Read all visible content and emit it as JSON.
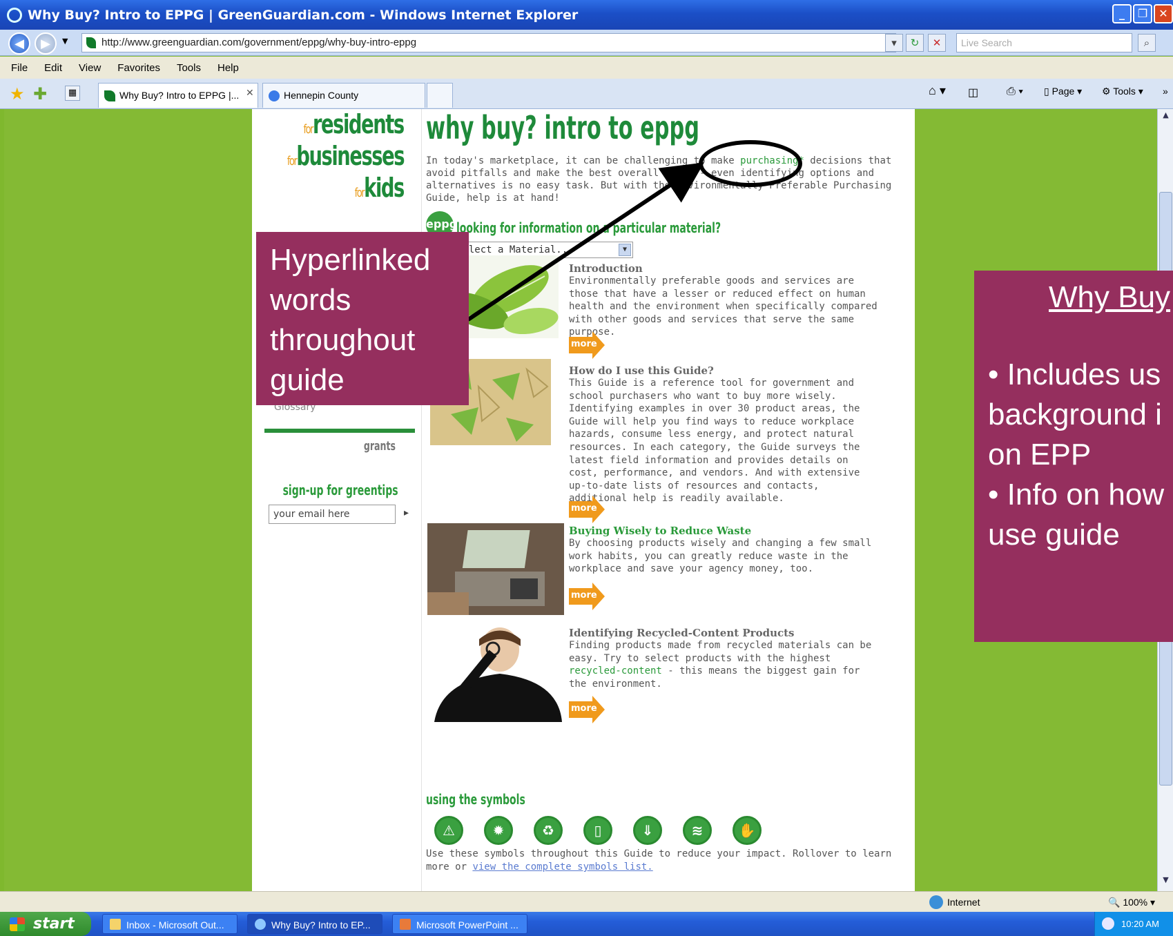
{
  "window": {
    "title": "Why Buy? Intro to EPPG | GreenGuardian.com - Windows Internet Explorer",
    "minimize_icon": "minimize-icon",
    "maximize_icon": "restore-icon",
    "close_icon": "close-icon"
  },
  "address": {
    "url": "http://www.greenguardian.com/government/eppg/why-buy-intro-eppg",
    "search_placeholder": "Live Search"
  },
  "menu": [
    "File",
    "Edit",
    "View",
    "Favorites",
    "Tools",
    "Help"
  ],
  "tabs": [
    {
      "label": "Why Buy? Intro to EPPG |...",
      "active": true
    },
    {
      "label": "Hennepin County",
      "active": false
    }
  ],
  "commands": {
    "page": "Page",
    "tools": "Tools"
  },
  "site": {
    "for_prefix": "for",
    "audiences": [
      "residents",
      "businesses",
      "kids"
    ],
    "glossary": "Glossary",
    "grants": "grants",
    "signup_title": "sign-up for greentips",
    "email_placeholder": "your email here",
    "email_go": "▸"
  },
  "main": {
    "heading": "why buy? intro to eppg",
    "intro_before": "In today's marketplace, it can be challenging to make ",
    "intro_link": "purchasing*",
    "intro_after": " decisions that avoid pitfalls and make the best overall sense - even identifying options and alternatives is no easy task. But with the Environmentally Preferable Purchasing Guide, help is at hand!",
    "badge": "eppg",
    "material_question": "looking for information on a particular material?",
    "material_select": "Select a Material...",
    "more_label": "more",
    "sections": [
      {
        "title": "Introduction",
        "body": "Environmentally preferable goods and services are those that have a lesser or reduced effect on human health and the environment when specifically compared with other goods and services that serve the same purpose."
      },
      {
        "title": "How do I use this Guide?",
        "body": "This Guide is a reference tool for government and school purchasers who want to buy more wisely. Identifying examples in over 30 product areas, the Guide will help you find ways to reduce workplace hazards, consume less energy, and protect natural resources. In each category, the Guide surveys the latest field information and provides details on cost, performance, and vendors. And with extensive up-to-date lists of resources and contacts, additional help is readily available."
      },
      {
        "title": "Buying Wisely to Reduce Waste",
        "body": "By choosing products wisely and changing a few small work habits, you can greatly reduce waste in the workplace and save your agency money, too."
      },
      {
        "title": "Identifying Recycled-Content Products",
        "body_before": "Finding products made from recycled materials can be easy. Try to select products with the highest ",
        "body_link": "recycled-content",
        "body_after": " - this means the biggest gain for the environment."
      }
    ],
    "symbols_title": "using the symbols",
    "symbols": [
      "warning-symbol-icon",
      "energy-symbol-icon",
      "recycle-symbol-icon",
      "container-symbol-icon",
      "water-symbol-icon",
      "air-symbol-icon",
      "hand-symbol-icon"
    ],
    "symbols_text": "Use these symbols throughout this Guide to reduce your impact. Rollover to learn more or ",
    "symbols_link": "view the complete symbols list."
  },
  "callout": {
    "lines": [
      "Hyperlinked",
      "words",
      "throughout",
      "guide"
    ]
  },
  "side_panel": {
    "title": "Why Buy",
    "lines": [
      "• Includes us",
      "background i",
      "on EPP",
      "• Info on how",
      "use guide"
    ]
  },
  "status": {
    "zone": "Internet",
    "zoom": "100%"
  },
  "taskbar": {
    "start": "start",
    "tasks": [
      "Inbox - Microsoft Out...",
      "Why Buy? Intro to EP...",
      "Microsoft PowerPoint ..."
    ],
    "clock": "10:20 AM"
  },
  "colors": {
    "brand_green": "#1e8a3a",
    "accent_orange": "#e89c1c",
    "callout": "#952f5e",
    "page_bg": "#84ba34"
  }
}
